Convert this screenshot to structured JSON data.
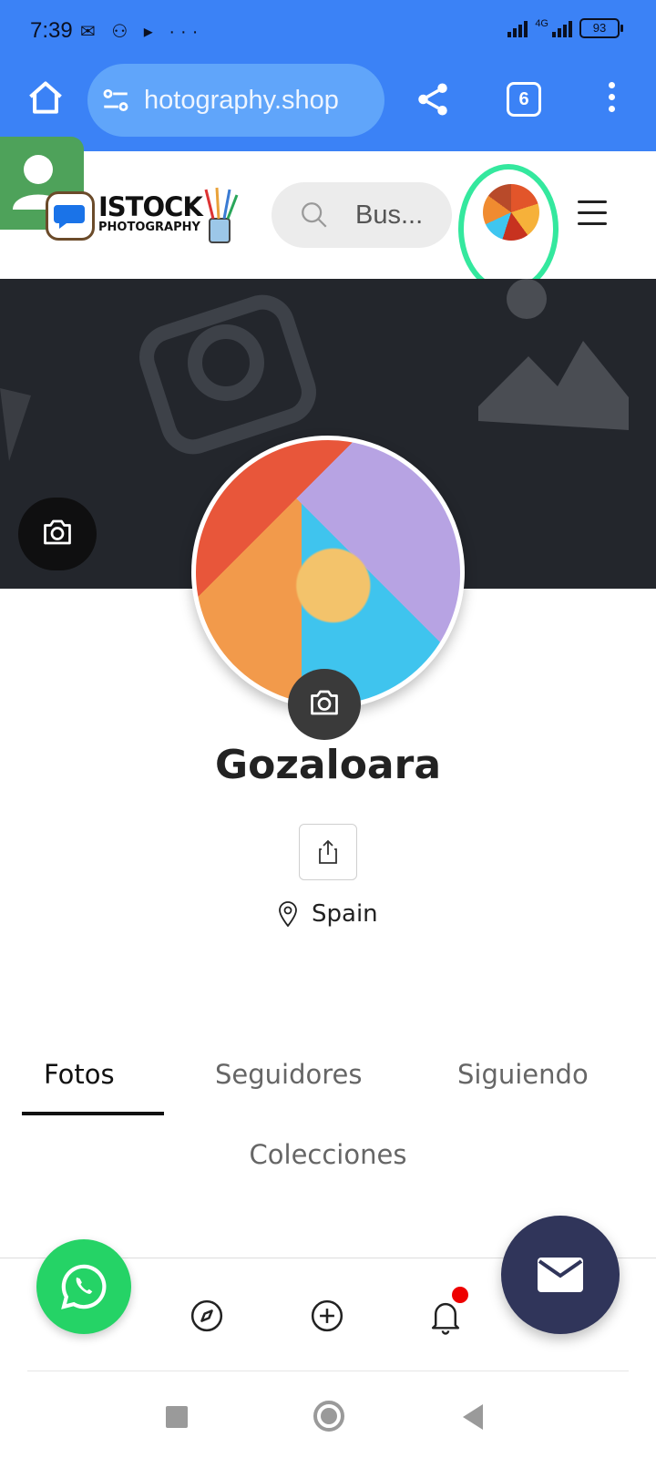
{
  "status_bar": {
    "time": "7:39",
    "network_label": "4G",
    "battery": "93"
  },
  "browser": {
    "url": "hotography.shop",
    "tab_count": "6"
  },
  "site_header": {
    "logo_text": "ISTOCK",
    "logo_subtext": "PHOTOGRAPHY",
    "search_placeholder": "Bus..."
  },
  "profile": {
    "name": "Gozaloara",
    "location": "Spain"
  },
  "tabs": [
    {
      "label": "Fotos",
      "active": true
    },
    {
      "label": "Seguidores",
      "active": false
    },
    {
      "label": "Siguiendo",
      "active": false
    },
    {
      "label": "Colecciones",
      "active": false
    }
  ],
  "colors": {
    "browser_blue": "#3b82f6",
    "highlight_ring": "#34e89e",
    "whatsapp": "#25d366",
    "mail_button": "#30355a",
    "cover": "#23262c"
  },
  "icons": {
    "browser": [
      "home-icon",
      "tune-icon",
      "share-icon",
      "tabs-icon",
      "more-vert-icon"
    ],
    "header": [
      "search-icon",
      "hamburger-menu-icon"
    ],
    "profile": [
      "camera-icon",
      "share-upload-icon",
      "location-pin-icon"
    ],
    "bottom_nav": [
      "compass-icon",
      "plus-circle-icon",
      "bell-icon",
      "whatsapp-icon",
      "mail-icon"
    ]
  }
}
